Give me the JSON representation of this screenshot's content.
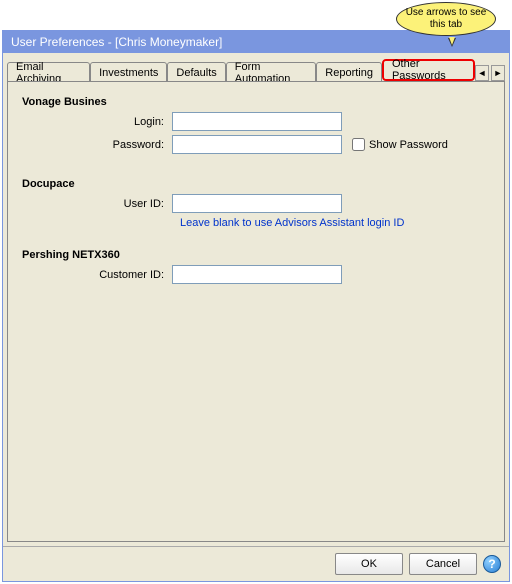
{
  "callout": {
    "text": "Use arrows to see this tab"
  },
  "window": {
    "title": "User Preferences -  [Chris Moneymaker]"
  },
  "tabs": {
    "items": [
      {
        "label": "Email Archiving"
      },
      {
        "label": "Investments"
      },
      {
        "label": "Defaults"
      },
      {
        "label": "Form Automation"
      },
      {
        "label": "Reporting"
      },
      {
        "label": "Other Passwords"
      }
    ],
    "nav": {
      "left": "◄",
      "right": "►"
    }
  },
  "sections": {
    "vonage": {
      "title": "Vonage Busines",
      "login_label": "Login:",
      "login_value": "",
      "password_label": "Password:",
      "password_value": "",
      "show_pw_label": "Show Password"
    },
    "docupace": {
      "title": "Docupace",
      "userid_label": "User ID:",
      "userid_value": "",
      "hint": "Leave blank to use Advisors Assistant login ID"
    },
    "pershing": {
      "title": "Pershing NETX360",
      "custid_label": "Customer ID:",
      "custid_value": ""
    }
  },
  "footer": {
    "ok": "OK",
    "cancel": "Cancel",
    "help": "?"
  }
}
